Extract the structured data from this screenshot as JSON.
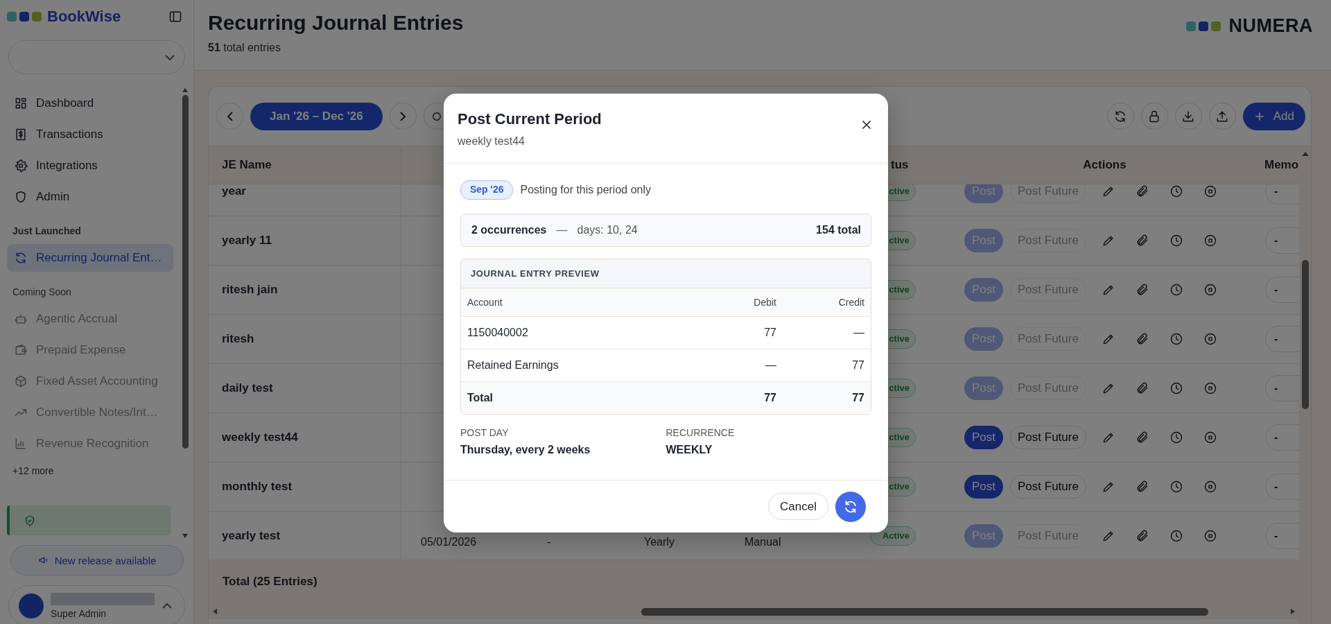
{
  "sidebar": {
    "brand": "BookWise",
    "items": [
      {
        "kind": "link",
        "label": "Dashboard",
        "selected": false,
        "disabled": false
      },
      {
        "kind": "link",
        "label": "Transactions",
        "selected": false,
        "disabled": false
      },
      {
        "kind": "link",
        "label": "Integrations",
        "selected": false,
        "disabled": false
      },
      {
        "kind": "link",
        "label": "Admin",
        "selected": false,
        "disabled": false
      },
      {
        "kind": "heading",
        "label": "Just Launched"
      },
      {
        "kind": "link",
        "label": "Recurring Journal Ent…",
        "selected": true,
        "disabled": false
      },
      {
        "kind": "subheading",
        "label": "Coming Soon"
      },
      {
        "kind": "link",
        "label": "Agentic Accrual",
        "selected": false,
        "disabled": true
      },
      {
        "kind": "link",
        "label": "Prepaid Expense",
        "selected": false,
        "disabled": true
      },
      {
        "kind": "link",
        "label": "Fixed Asset Accounting",
        "selected": false,
        "disabled": true
      },
      {
        "kind": "link",
        "label": "Convertible Notes/Int…",
        "selected": false,
        "disabled": true
      },
      {
        "kind": "link",
        "label": "Revenue Recognition",
        "selected": false,
        "disabled": true
      },
      {
        "kind": "more",
        "label": "+12 more"
      }
    ],
    "release_button": "New release available",
    "user": {
      "role": "Super Admin"
    }
  },
  "page": {
    "title": "Recurring Journal Entries",
    "subtitle": "**51** total entries",
    "logo": "NUMERA"
  },
  "toolbar": {
    "date_range": "Jan '26 – Dec '26",
    "add_label": "Add"
  },
  "table": {
    "columns": [
      "JE Name",
      "tus",
      "Actions",
      "Memo"
    ],
    "rows": [
      {
        "name": "year",
        "status": "ctive",
        "post": "Post",
        "post_future": "Post Future",
        "disabled": true,
        "memo": "-"
      },
      {
        "name": "yearly 11",
        "status": "ctive",
        "post": "Post",
        "post_future": "Post Future",
        "disabled": true,
        "memo": "-"
      },
      {
        "name": "ritesh jain",
        "status": "ctive",
        "post": "Post",
        "post_future": "Post Future",
        "disabled": true,
        "memo": "-"
      },
      {
        "name": "ritesh",
        "status": "ctive",
        "post": "Post",
        "post_future": "Post Future",
        "disabled": true,
        "memo": "-"
      },
      {
        "name": "daily test",
        "status": "ctive",
        "post": "Post",
        "post_future": "Post Future",
        "disabled": true,
        "memo": "-"
      },
      {
        "name": "weekly test44",
        "status": "ctive",
        "post": "Post",
        "post_future": "Post Future",
        "disabled": false,
        "memo": "-"
      },
      {
        "name": "monthly test",
        "status": "ctive",
        "post": "Post",
        "post_future": "Post Future",
        "disabled": false,
        "memo": "-"
      },
      {
        "name": "yearly test",
        "cells": [
          "05/01/2026",
          "-",
          "Yearly",
          "Manual"
        ],
        "status": "Active",
        "post": "Post",
        "post_future": "Post Future",
        "disabled": true,
        "memo": "-"
      }
    ],
    "footer": "Total (25 Entries)"
  },
  "dialog": {
    "title": "Post Current Period",
    "subtitle": "weekly test44",
    "period_badge": "Sep '26",
    "period_note": "Posting for this period only",
    "summary": {
      "occurrences": "2 occurrences",
      "separator": "—",
      "days": "days: 10, 24",
      "total": "154 total"
    },
    "preview": {
      "title": "JOURNAL ENTRY PREVIEW",
      "columns": [
        "Account",
        "Debit",
        "Credit"
      ],
      "rows": [
        [
          "1150040002",
          "77",
          "—"
        ],
        [
          "Retained Earnings",
          "—",
          "77"
        ]
      ],
      "total": [
        "Total",
        "77",
        "77"
      ]
    },
    "details": [
      {
        "label": "POST DAY",
        "value": "Thursday, every 2 weeks"
      },
      {
        "label": "RECURRENCE",
        "value": "WEEKLY"
      }
    ],
    "cancel": "Cancel"
  }
}
